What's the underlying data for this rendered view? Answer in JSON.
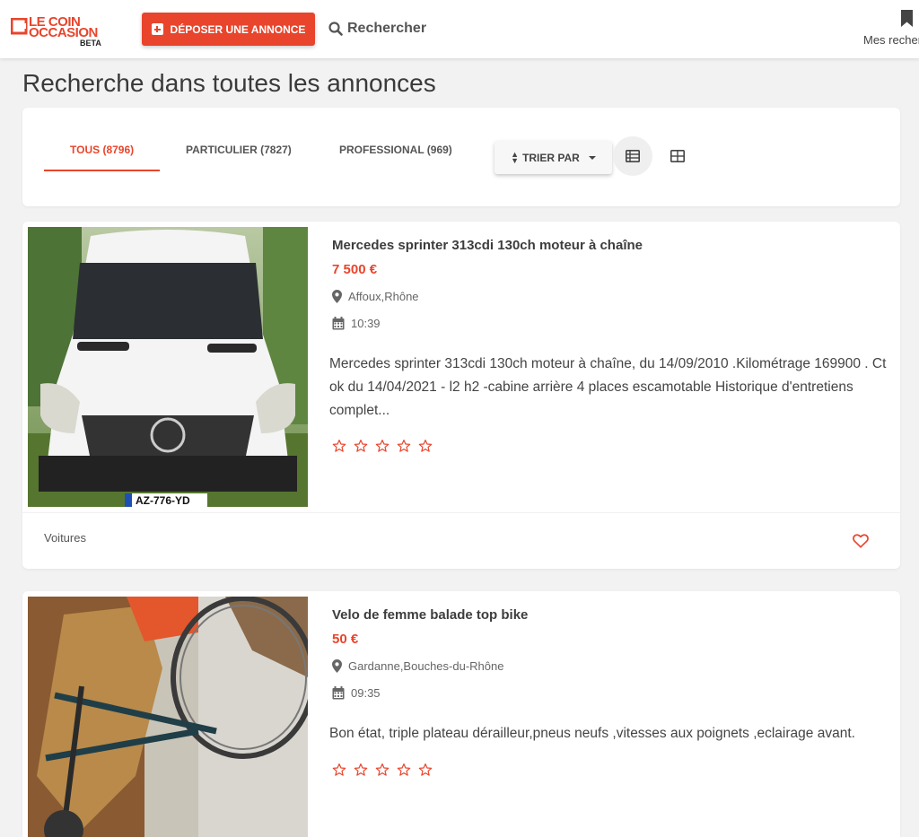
{
  "header": {
    "logo_line1": "LE COIN",
    "logo_line2": "OCCASION",
    "logo_badge": "BETA",
    "post_button": "DÉPOSER UNE ANNONCE",
    "search_link": "Rechercher",
    "saved_searches": "Mes recherches"
  },
  "page": {
    "title": "Recherche dans toutes les annonces"
  },
  "filters": {
    "tabs": [
      {
        "label": "TOUS (8796)",
        "active": true
      },
      {
        "label": "PARTICULIER (7827)",
        "active": false
      },
      {
        "label": "PROFESSIONAL (969)",
        "active": false
      }
    ],
    "sort_label": "TRIER PAR"
  },
  "listings": [
    {
      "title": "Mercedes sprinter 313cdi 130ch moteur à chaîne",
      "price": "7 500 €",
      "location": "Affoux,Rhône",
      "time": "10:39",
      "description": "Mercedes sprinter 313cdi 130ch moteur à chaîne, du 14/09/2010 .Kilométrage 169900 . Ct ok du 14/04/2021 - l2 h2 -cabine arrière 4 places escamotable Historique d'entretiens complet...",
      "rating": 0,
      "category": "Voitures",
      "plate": "AZ-776-YD"
    },
    {
      "title": "Velo de femme balade top bike",
      "price": "50 €",
      "location": "Gardanne,Bouches-du-Rhône",
      "time": "09:35",
      "description": "Bon état, triple plateau dérailleur,pneus neufs ,vitesses aux poignets ,eclairage avant.",
      "rating": 0
    }
  ],
  "colors": {
    "accent": "#e8452c",
    "background": "#f2f2f2"
  }
}
